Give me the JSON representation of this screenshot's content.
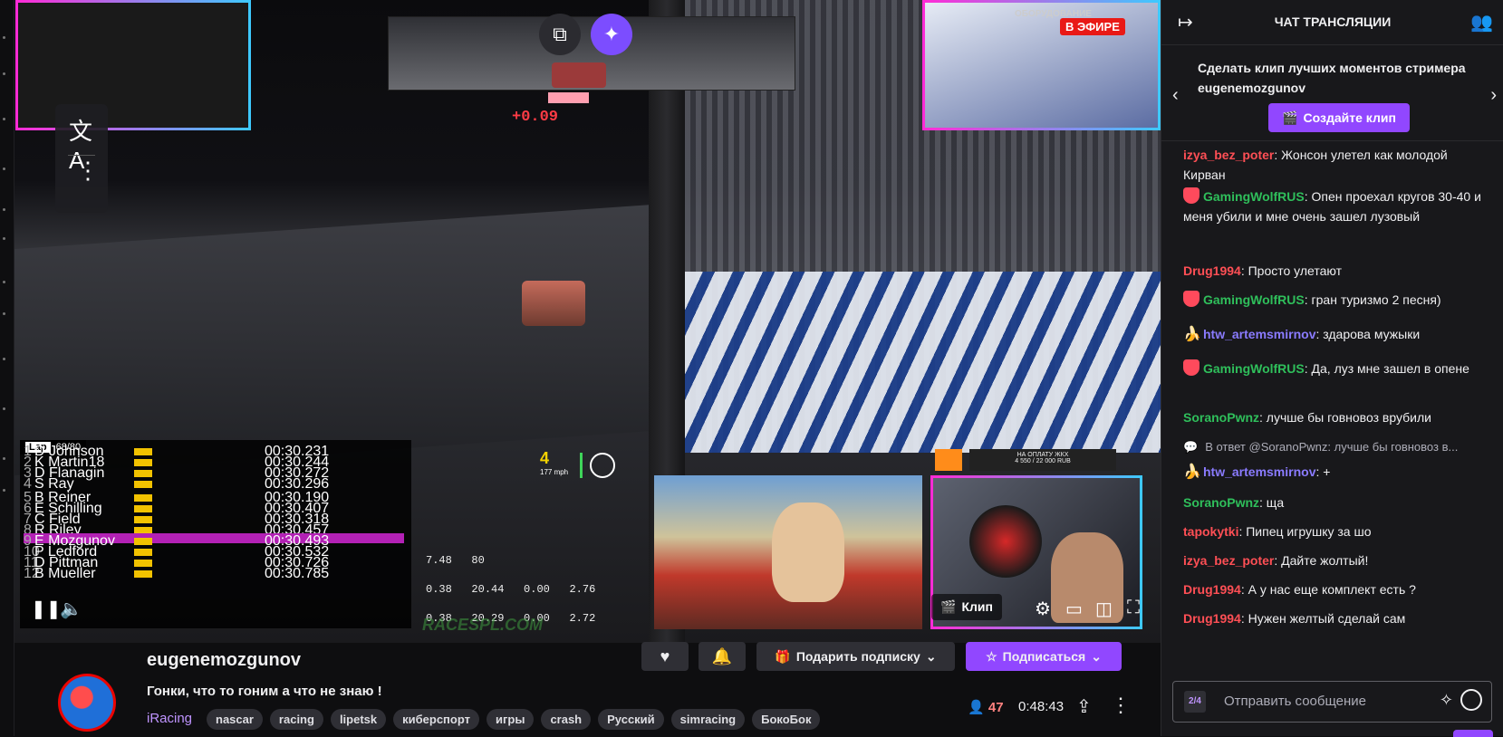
{
  "video": {
    "live_promo": "ОБОРУДОВАНИЕ\nДЛЯ",
    "live_badge": "В ЭФИРЕ",
    "delta": "+0.09",
    "lap_label": "Lap",
    "lap_value": "68/80",
    "gear": "4",
    "speed_unit": "177 mph",
    "stats": [
      "7.48",
      "80",
      "0.38",
      "20.44",
      "0.00",
      "2.76",
      "0.38",
      "20.29",
      "0.00",
      "2.72"
    ],
    "watermark": "RACESPL.COM",
    "donate": "НА ОПЛАТУ ЖКХ\n4 550 / 22 000 RUB",
    "drivers": [
      {
        "pos": "1",
        "name": "D Johnson",
        "last": "00:30.231"
      },
      {
        "pos": "2",
        "name": "K Martin18",
        "last": "00:30.244"
      },
      {
        "pos": "3",
        "name": "D Flanagin",
        "last": "00:30.272"
      },
      {
        "pos": "4",
        "name": "S Ray",
        "last": "00:30.296"
      },
      {
        "pos": "5",
        "name": "B Reiner",
        "last": "00:30.190"
      },
      {
        "pos": "6",
        "name": "E Schilling",
        "last": "00:30.407"
      },
      {
        "pos": "7",
        "name": "C Field",
        "last": "00:30.318"
      },
      {
        "pos": "8",
        "name": "R Riley",
        "last": "00:30.457"
      },
      {
        "pos": "9",
        "name": "E Mozgunov",
        "last": "00:30.493"
      },
      {
        "pos": "10",
        "name": "P Ledford",
        "last": "00:30.532"
      },
      {
        "pos": "11",
        "name": "D Pittman",
        "last": "00:30.726"
      },
      {
        "pos": "12",
        "name": "B Mueller",
        "last": "00:30.785"
      }
    ],
    "clip_label": "Клип"
  },
  "info": {
    "streamer": "eugenemozgunov",
    "title": "Гонки, что то гоним а что не знаю !",
    "game": "iRacing",
    "tags": [
      "nascar",
      "racing",
      "lipetsk",
      "киберспорт",
      "игры",
      "crash",
      "Русский",
      "simracing",
      "БокоБок"
    ],
    "gift_label": "Подарить подписку",
    "subscribe_label": "Подписаться",
    "viewers": "47",
    "uptime": "0:48:43"
  },
  "chat": {
    "header": "ЧАТ ТРАНСЛЯЦИИ",
    "promo_text": "Сделать клип лучших моментов стримера eugenemozgunov",
    "promo_button": "Создайте клип",
    "messages": [
      {
        "user": "izya_bez_poter",
        "color": "#ff4f55",
        "text": ": Жонсон улетел как молодой Кирван"
      },
      {
        "user": "GamingWolfRUS",
        "color": "#2fbf5b",
        "text": ": Опен проехал кругов 30-40 и меня убили и мне очень зашел лузовый"
      },
      {
        "user": "Drug1994",
        "color": "#ff4f55",
        "text": ": Просто улетают"
      },
      {
        "user": "GamingWolfRUS",
        "color": "#2fbf5b",
        "text": ": гран туризмо 2 песня)"
      },
      {
        "user": "htw_artemsmirnov",
        "color": "#8a7bff",
        "text": ": здарова мужыки"
      },
      {
        "user": "GamingWolfRUS",
        "color": "#2fbf5b",
        "text": ": Да, луз мне зашел в опене"
      },
      {
        "user": "SoranoPwnz",
        "color": "#2fbf5b",
        "text": ": лучше бы говновоз врубили"
      },
      {
        "user": "htw_artemsmirnov",
        "color": "#8a7bff",
        "text": ": +"
      },
      {
        "user": "SoranoPwnz",
        "color": "#2fbf5b",
        "text": ": ща"
      },
      {
        "user": "tapokytki",
        "color": "#ff4f55",
        "text": ": Пипец игрушку за шо"
      },
      {
        "user": "izya_bez_poter",
        "color": "#ff4f55",
        "text": ": Дайте жолтый!"
      },
      {
        "user": "Drug1994",
        "color": "#ff4f55",
        "text": ": А у нас еще комплект есть ?"
      },
      {
        "user": "Drug1994",
        "color": "#ff4f55",
        "text": ": Нужен желтый сделай сам"
      }
    ],
    "reply_text": "В ответ @SoranoPwnz: лучше бы говновоз в...",
    "input_placeholder": "Отправить сообщение",
    "points_badge": "2/4"
  }
}
